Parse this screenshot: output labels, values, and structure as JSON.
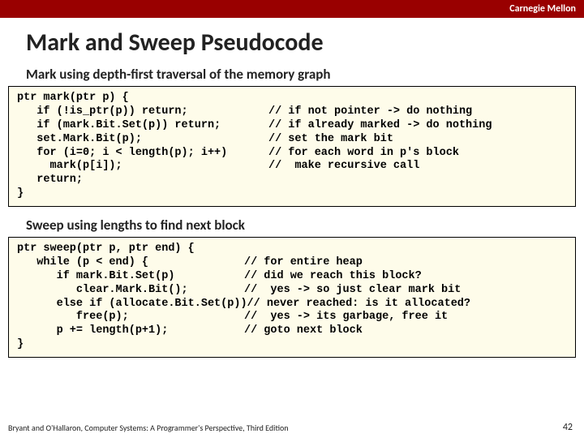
{
  "brand": "Carnegie Mellon",
  "title": "Mark and Sweep Pseudocode",
  "subhead_mark": "Mark using depth-first traversal of the memory graph",
  "mark_code": [
    {
      "code": "ptr mark(ptr p) {",
      "comment": ""
    },
    {
      "code": "   if (!is_ptr(p)) return;",
      "comment": "// if not pointer -> do nothing"
    },
    {
      "code": "   if (mark.Bit.Set(p)) return;",
      "comment": "// if already marked -> do nothing"
    },
    {
      "code": "   set.Mark.Bit(p);",
      "comment": "// set the mark bit"
    },
    {
      "code": "   for (i=0; i < length(p); i++)",
      "comment": "// for each word in p's block"
    },
    {
      "code": "     mark(p[i]);",
      "comment": "//  make recursive call"
    },
    {
      "code": "   return;",
      "comment": ""
    },
    {
      "code": "}",
      "comment": ""
    }
  ],
  "subhead_sweep": "Sweep using lengths to find next block",
  "sweep_code": [
    {
      "code": "ptr sweep(ptr p, ptr end) {",
      "comment": ""
    },
    {
      "code": "   while (p < end) {",
      "comment": "// for entire heap"
    },
    {
      "code": "      if mark.Bit.Set(p)",
      "comment": "// did we reach this block?"
    },
    {
      "code": "         clear.Mark.Bit();",
      "comment": "//  yes -> so just clear mark bit"
    },
    {
      "code": "      else if (allocate.Bit.Set(p))",
      "comment": "// never reached: is it allocated?"
    },
    {
      "code": "         free(p);",
      "comment": "//  yes -> its garbage, free it"
    },
    {
      "code": "      p += length(p+1);",
      "comment": "// goto next block"
    },
    {
      "code": "}",
      "comment": ""
    }
  ],
  "footer": "Bryant and O'Hallaron, Computer Systems: A Programmer's Perspective, Third Edition",
  "pagenum": "42"
}
